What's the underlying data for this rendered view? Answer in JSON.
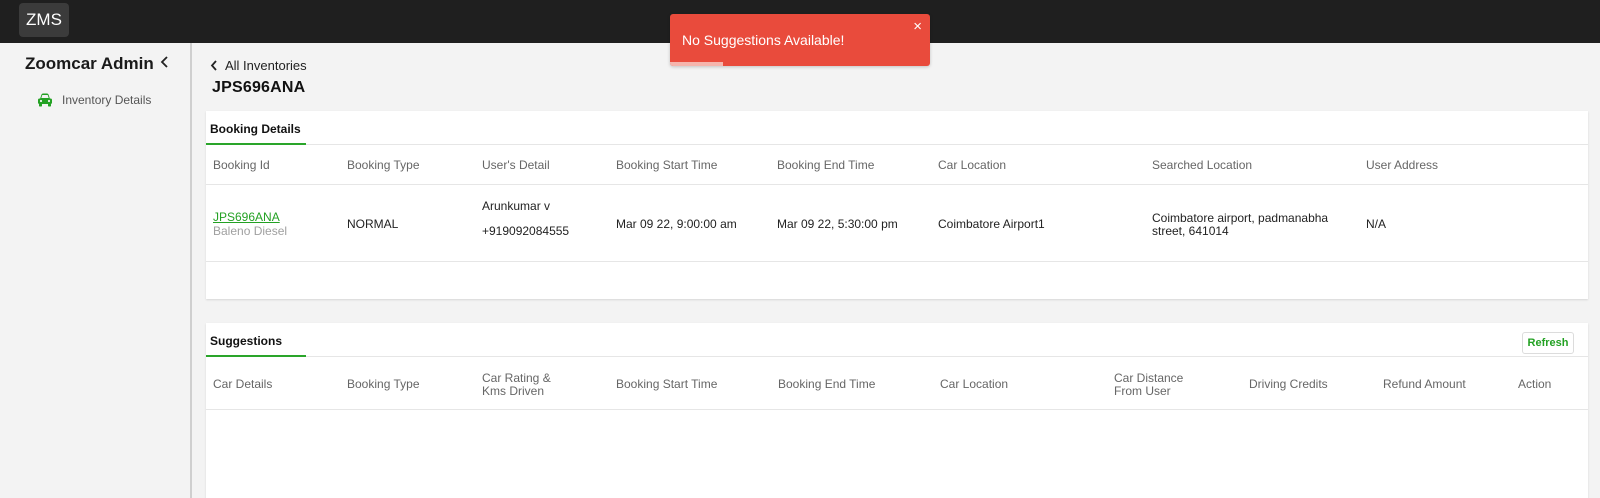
{
  "topbar": {
    "logo": "ZMS"
  },
  "sidebar": {
    "title": "Zoomcar Admin",
    "items": [
      {
        "label": "Inventory Details",
        "icon": "car-icon",
        "color": "#23a123"
      }
    ]
  },
  "main": {
    "back_label": "All Inventories",
    "title": "JPS696ANA",
    "booking": {
      "tab": "Booking Details",
      "headers": [
        "Booking Id",
        "Booking Type",
        "User's Detail",
        "Booking Start Time",
        "Booking End Time",
        "Car Location",
        "Searched Location",
        "User Address"
      ],
      "row": {
        "booking_id": "JPS696ANA",
        "car_model": "Baleno Diesel",
        "booking_type": "NORMAL",
        "user_name": "Arunkumar v",
        "user_phone": "+919092084555",
        "start_time": "Mar 09 22, 9:00:00 am",
        "end_time": "Mar 09 22, 5:30:00 pm",
        "car_location": "Coimbatore Airport1",
        "searched_location_line1": "Coimbatore airport, padmanabha",
        "searched_location_line2": "street, 641014",
        "user_address": "N/A"
      }
    },
    "suggestions": {
      "tab": "Suggestions",
      "refresh_label": "Refresh",
      "headers": {
        "car_details": "Car Details",
        "booking_type": "Booking Type",
        "rating_1": "Car Rating &",
        "rating_2": "Kms Driven",
        "start_time": "Booking Start Time",
        "end_time": "Booking End Time",
        "car_location": "Car Location",
        "distance_1": "Car Distance",
        "distance_2": "From User",
        "driving_credits": "Driving Credits",
        "refund_amount": "Refund Amount",
        "action": "Action"
      }
    }
  },
  "toast": {
    "message": "No Suggestions Available!",
    "close": "×",
    "color": "#e94b3c"
  },
  "colors": {
    "accent": "#23a123",
    "topbar": "#1f1f1f"
  }
}
